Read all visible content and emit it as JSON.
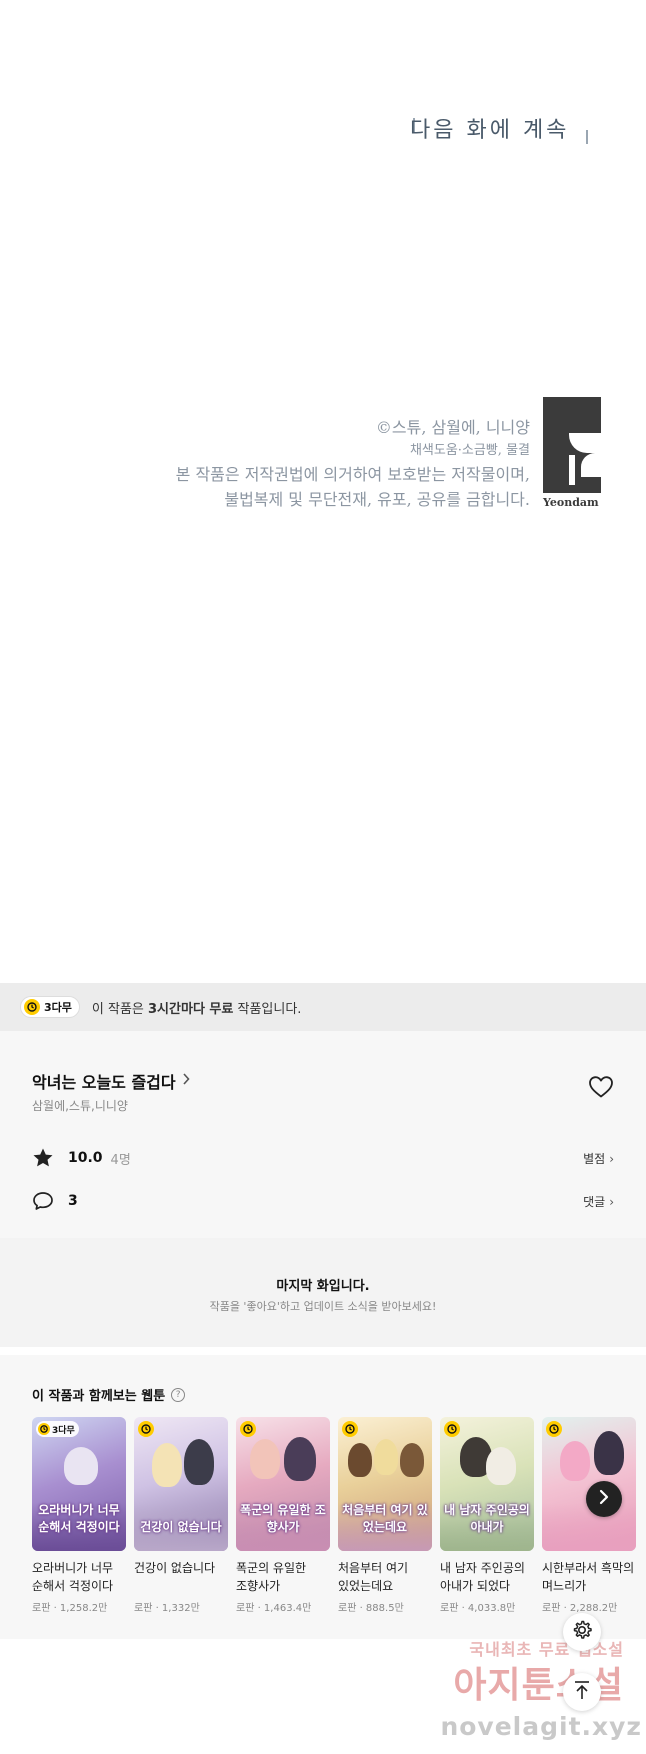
{
  "comic": {
    "next_note": "다음 화에 계속",
    "copyright_line1": "©스튜, 삼월에, 니니양",
    "copyright_line2": "채색도움·소금빵, 물결",
    "copyright_line3": "본 작품은 저작권법에 의거하여 보호받는 저작물이며,",
    "copyright_line4": "불법복제 및 무단전재, 유포, 공유를 금합니다.",
    "publisher_logo": "Yeondam"
  },
  "free_banner": {
    "badge": "3다무",
    "text_prefix": "이 작품은 ",
    "text_bold": "3시간마다 무료",
    "text_suffix": " 작품입니다."
  },
  "work": {
    "title": "악녀는 오늘도 즐겁다",
    "authors": "삼월에,스튜,니니양",
    "rating": "10.0",
    "rating_count": "4명",
    "rating_link": "별점",
    "comments": "3",
    "comments_link": "댓글"
  },
  "last_episode": {
    "title": "마지막 화입니다.",
    "subtitle": "작품을 '좋아요'하고 업데이트 소식을 받아보세요!"
  },
  "recommendations": {
    "heading": "이 작품과 함께보는 웹툰",
    "items": [
      {
        "title": "오라버니가 너무 순해서 걱정이다",
        "meta": "로판 · 1,258.2만",
        "badge": "3다무",
        "cover_text": "오라버니가 너무 순해서 걱정이다"
      },
      {
        "title": "건강이 없습니다",
        "meta": "로판 · 1,332만",
        "badge": "",
        "cover_text": "건강이 없습니다"
      },
      {
        "title": "폭군의 유일한 조향사가 되었습니다",
        "meta": "로판 · 1,463.4만",
        "badge": "",
        "cover_text": "폭군의 유일한 조향사가"
      },
      {
        "title": "처음부터 여기 있었는데요",
        "meta": "로판 · 888.5만",
        "badge": "",
        "cover_text": "처음부터 여기 있었는데요"
      },
      {
        "title": "내 남자 주인공의 아내가 되었다",
        "meta": "로판 · 4,033.8만",
        "badge": "",
        "cover_text": "내 남자 주인공의 아내가"
      },
      {
        "title": "시한부라서 흑막의 며느리가 되었는데요",
        "meta": "로판 · 2,288.2만",
        "badge": "",
        "cover_text": ""
      }
    ]
  },
  "watermark": {
    "line1": "국내최초 무료 웹소설",
    "line2": "아지툰소설",
    "line3": "novelagit.xyz"
  },
  "colors": {
    "accent_yellow": "#ffcc00",
    "banner_bg": "#ececec",
    "section_bg": "#f7f7f7"
  }
}
